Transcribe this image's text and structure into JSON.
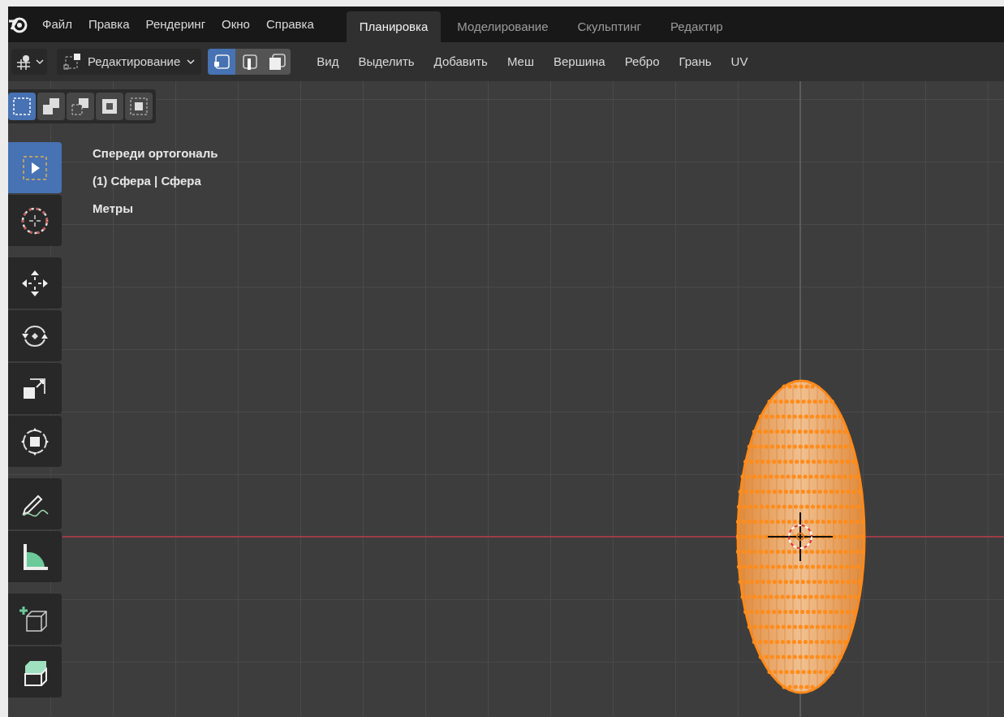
{
  "top_bar": {
    "menus": [
      "Файл",
      "Правка",
      "Рендеринг",
      "Окно",
      "Справка"
    ],
    "workspaces": [
      {
        "label": "Планировка",
        "selected": true
      },
      {
        "label": "Моделирование",
        "selected": false
      },
      {
        "label": "Скульптинг",
        "selected": false
      },
      {
        "label": "Редактир",
        "selected": false
      }
    ]
  },
  "header": {
    "mode": "Редактирование",
    "select_modes": [
      {
        "kind": "vertex",
        "selected": true
      },
      {
        "kind": "edge",
        "selected": false
      },
      {
        "kind": "face",
        "selected": false
      }
    ],
    "menus": [
      "Вид",
      "Выделить",
      "Добавить",
      "Меш",
      "Вершина",
      "Ребро",
      "Грань",
      "UV"
    ]
  },
  "box_modes": [
    {
      "kind": "new",
      "selected": true
    },
    {
      "kind": "extend",
      "selected": false
    },
    {
      "kind": "subtract",
      "selected": false
    },
    {
      "kind": "invert",
      "selected": false
    },
    {
      "kind": "intersect",
      "selected": false
    }
  ],
  "viewport": {
    "info": [
      "Спереди ортогональ",
      "(1) Сфера | Сфера",
      "Метры"
    ]
  },
  "toolbar": {
    "groups": [
      {
        "tools": [
          {
            "kind": "select",
            "selected": true
          },
          {
            "kind": "cursor",
            "selected": false
          }
        ]
      },
      {
        "tools": [
          {
            "kind": "move",
            "selected": false
          },
          {
            "kind": "rotate",
            "selected": false
          },
          {
            "kind": "scale",
            "selected": false
          },
          {
            "kind": "transform",
            "selected": false
          }
        ]
      },
      {
        "tools": [
          {
            "kind": "annotate",
            "selected": false
          },
          {
            "kind": "measure",
            "selected": false
          }
        ]
      },
      {
        "tools": [
          {
            "kind": "add-cube",
            "selected": false
          },
          {
            "kind": "extrude",
            "selected": false
          }
        ]
      }
    ]
  }
}
